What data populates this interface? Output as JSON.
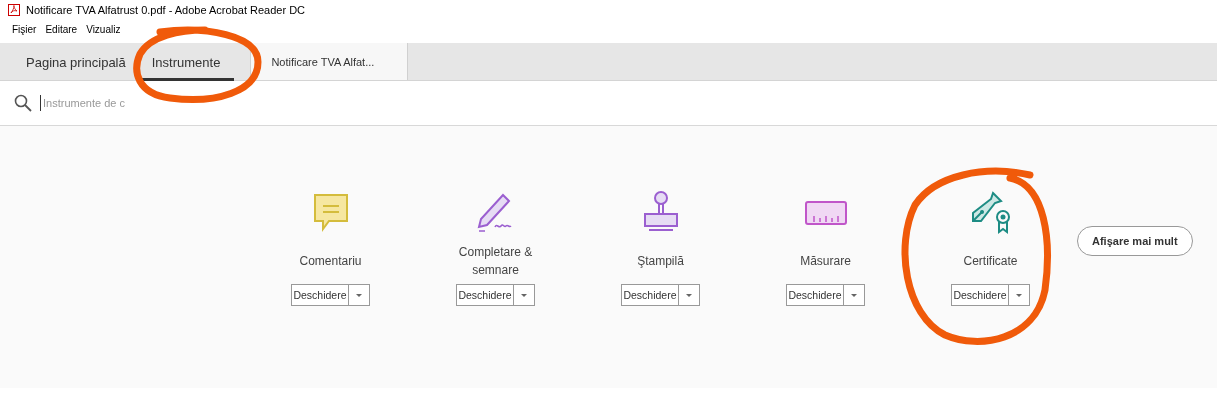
{
  "window": {
    "title": "Notificare TVA Alfatrust 0.pdf - Adobe Acrobat Reader DC"
  },
  "menu": [
    "Fişier",
    "Editare",
    "Vizualiz"
  ],
  "tabs": [
    {
      "label": "Pagina principală",
      "selected": false
    },
    {
      "label": "Instrumente",
      "selected": true
    }
  ],
  "document_tab": {
    "label": "Notificare TVA Alfat..."
  },
  "search": {
    "placeholder": "Instrumente de c"
  },
  "tools": [
    {
      "kind": "comment",
      "label": "Comentariu",
      "button": "Deschidere"
    },
    {
      "kind": "sign",
      "label": "Completare & semnare",
      "button": "Deschidere"
    },
    {
      "kind": "stamp",
      "label": "Ştampilă",
      "button": "Deschidere"
    },
    {
      "kind": "measure",
      "label": "Măsurare",
      "button": "Deschidere"
    },
    {
      "kind": "certificate",
      "label": "Certificate",
      "button": "Deschidere"
    }
  ],
  "more_button": "Afişare mai mult"
}
